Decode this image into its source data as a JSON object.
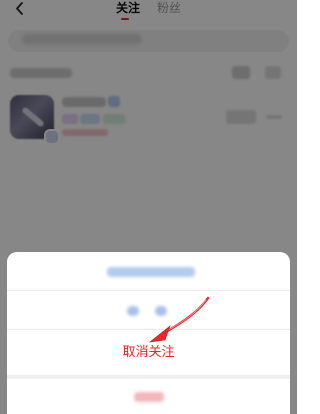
{
  "nav": {
    "back_icon": "chevron-left-icon",
    "tabs": [
      {
        "label": "关注",
        "active": true
      },
      {
        "label": "粉丝",
        "active": false
      }
    ],
    "active_color": "#e02e24"
  },
  "sheet": {
    "unfollow_label": "取消关注",
    "destructive_color": "#e8262b"
  },
  "annotation": {
    "arrow_color": "#e8262b",
    "icon": "pointer-arrow-icon"
  },
  "overlay_color": "rgba(0,0,0,0.47)"
}
